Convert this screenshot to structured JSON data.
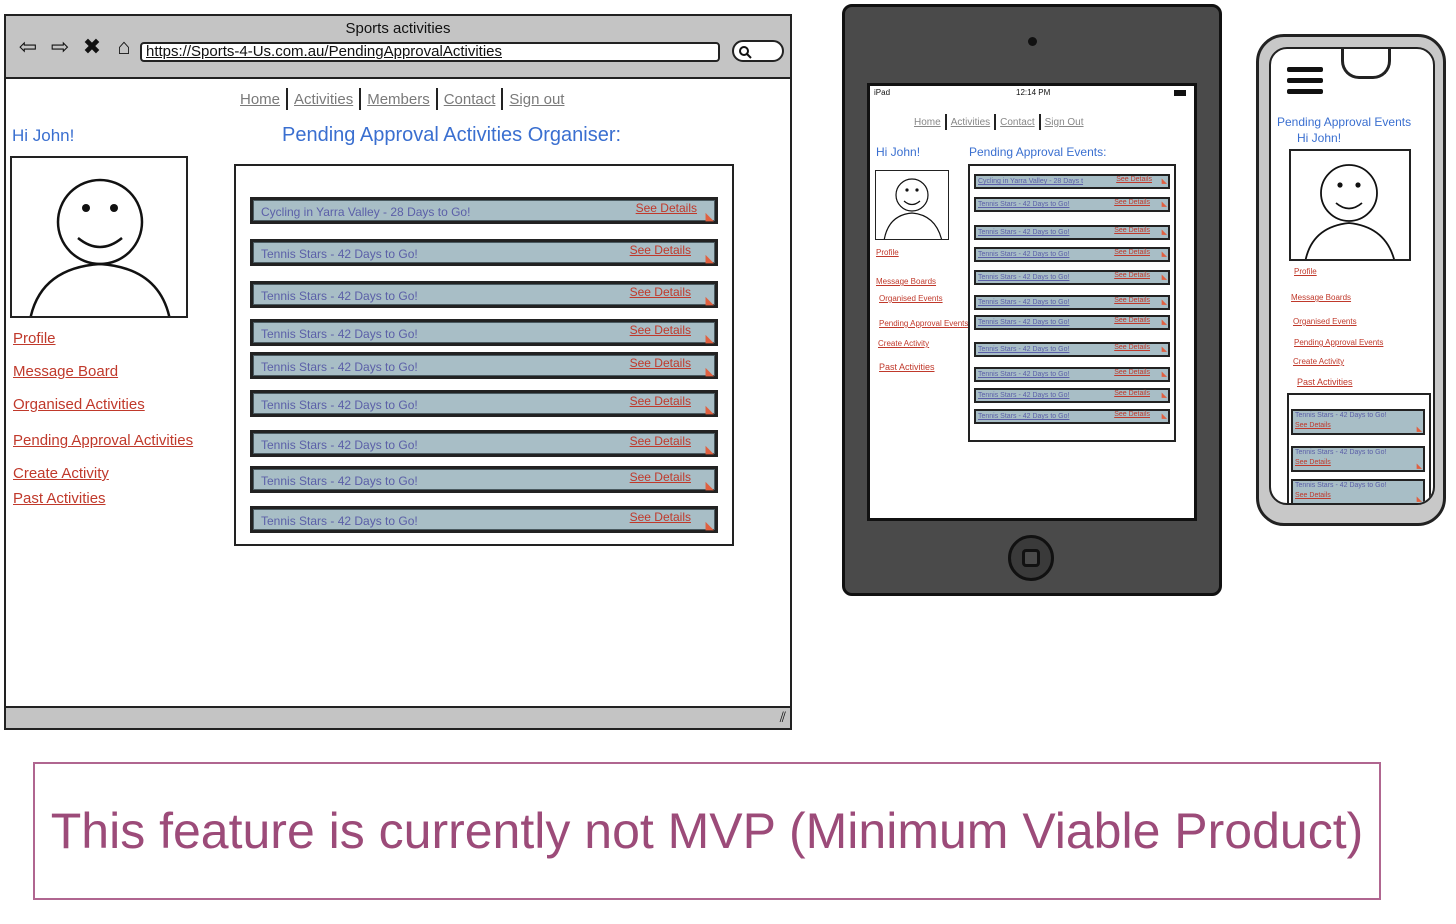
{
  "desktop": {
    "window_title": "Sports activities",
    "url": "https://Sports-4-Us.com.au/PendingApprovalActivities",
    "nav_icons": [
      "back-icon",
      "forward-icon",
      "close-icon",
      "home-icon",
      "search-icon",
      "resize-grip-icon"
    ],
    "nav": [
      "Home",
      "Activities",
      "Members",
      "Contact",
      "Sign out"
    ],
    "greeting": "Hi John!",
    "heading": "Pending Approval Activities Organiser:",
    "sidebar": [
      "Profile",
      "Message Board",
      "Organised Activities",
      "Pending Approval Activities",
      "Create Activity",
      "Past Activities"
    ],
    "rows": [
      {
        "title": "Cycling in Yarra Valley - 28 Days to Go!",
        "link": "See Details"
      },
      {
        "title": "Tennis Stars - 42 Days to Go!",
        "link": "See Details"
      },
      {
        "title": "Tennis Stars - 42 Days to Go!",
        "link": "See Details"
      },
      {
        "title": "Tennis Stars - 42 Days to Go!",
        "link": "See Details"
      },
      {
        "title": "Tennis Stars - 42 Days to Go!",
        "link": "See Details"
      },
      {
        "title": "Tennis Stars - 42 Days to Go!",
        "link": "See Details"
      },
      {
        "title": "Tennis Stars - 42 Days to Go!",
        "link": "See Details"
      },
      {
        "title": "Tennis Stars - 42 Days to Go!",
        "link": "See Details"
      },
      {
        "title": "Tennis Stars - 42 Days to Go!",
        "link": "See Details"
      }
    ]
  },
  "tablet": {
    "status_left": "iPad",
    "status_time": "12:14 PM",
    "nav": [
      "Home",
      "Activities",
      "Contact",
      "Sign Out"
    ],
    "greeting": "Hi John!",
    "heading": "Pending Approval Events:",
    "sidebar": [
      "Profile",
      "Message Boards",
      "Organised Events",
      "Pending Approval Events",
      "Create Activity",
      "Past Activities"
    ],
    "rows": [
      {
        "title": "Cycling in Yarra Valley - 28 Days t",
        "link": "See Details"
      },
      {
        "title": "Tennis Stars - 42 Days to Go!",
        "link": "See Details"
      },
      {
        "title": "Tennis Stars - 42 Days to Go!",
        "link": "See Details"
      },
      {
        "title": "Tennis Stars - 42 Days to Go!",
        "link": "See Details"
      },
      {
        "title": "Tennis Stars - 42 Days to Go!",
        "link": "See Details"
      },
      {
        "title": "Tennis Stars - 42 Days to Go!",
        "link": "See Details"
      },
      {
        "title": "Tennis Stars - 42 Days to Go!",
        "link": "See Details"
      },
      {
        "title": "Tennis Stars - 42 Days to Go!",
        "link": "See Details"
      },
      {
        "title": "Tennis Stars - 42 Days to Go!",
        "link": "See Details"
      },
      {
        "title": "Tennis Stars - 42 Days to Go!",
        "link": "See Details"
      },
      {
        "title": "Tennis Stars - 42 Days to Go!",
        "link": "See Details"
      }
    ]
  },
  "phone": {
    "heading": "Pending Approval Events",
    "greeting": "Hi John!",
    "sidebar": [
      "Profile",
      "Message Boards",
      "Organised Events",
      "Pending Approval Events",
      "Create Activity",
      "Past Activities"
    ],
    "rows": [
      {
        "title": "Tennis Stars - 42 Days to Go!",
        "link": "See Details"
      },
      {
        "title": "Tennis Stars - 42 Days to Go!",
        "link": "See Details"
      },
      {
        "title": "Tennis Stars - 42 Days to Go!",
        "link": "See Details"
      }
    ]
  },
  "note": "This feature is currently not MVP (Minimum Viable Product)",
  "colors": {
    "heading_blue": "#3a6fd0",
    "link_red": "#c0392b",
    "row_fill": "#a8bec6",
    "row_text": "#5b5fa8",
    "note_text": "#9c4b79",
    "chrome_gray": "#c4c4c4"
  }
}
